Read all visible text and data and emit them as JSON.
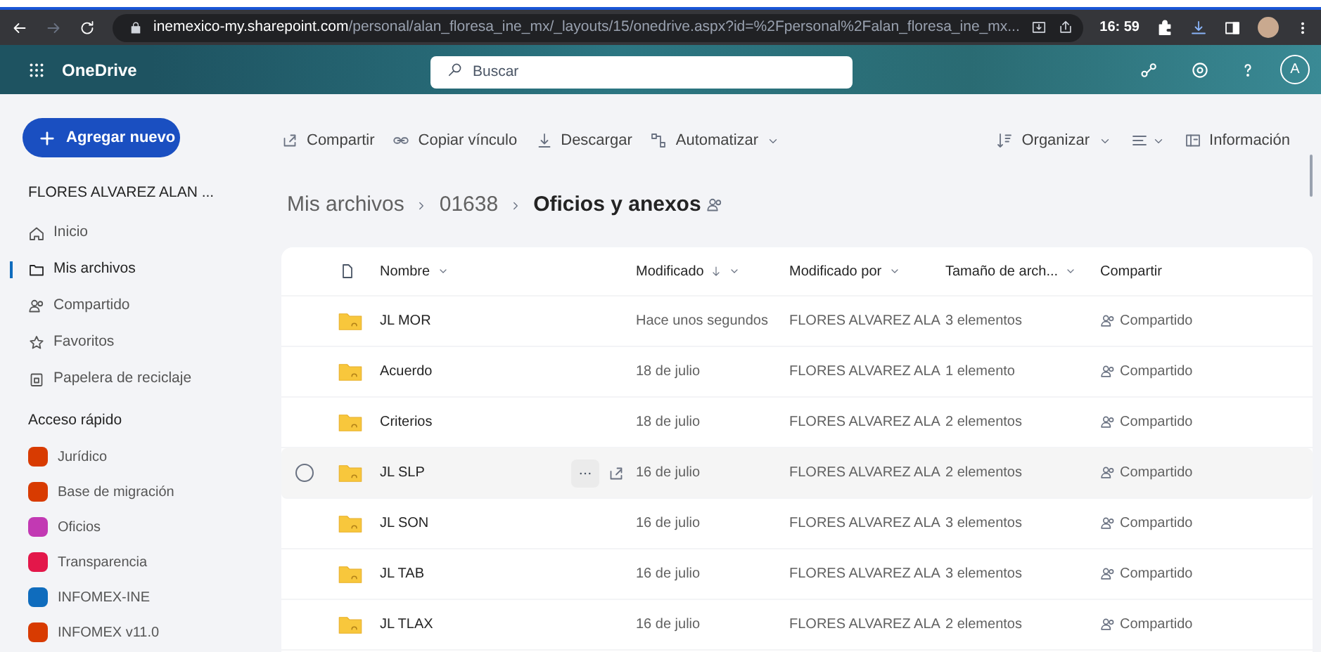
{
  "browser": {
    "url_host": "inemexico-my.sharepoint.com",
    "url_path": "/personal/alan_floresa_ine_mx/_layouts/15/onedrive.aspx?id=%2Fpersonal%2Falan_floresa_ine_mx...",
    "clock": "16: 59"
  },
  "app": {
    "name": "OneDrive",
    "search_placeholder": "Buscar",
    "avatar": "A"
  },
  "new_button": "Agregar nuevo",
  "toolbar_left": [
    {
      "label": "Compartir",
      "dropdown": false
    },
    {
      "label": "Copiar vínculo",
      "dropdown": false
    },
    {
      "label": "Descargar",
      "dropdown": false
    },
    {
      "label": "Automatizar",
      "dropdown": true
    }
  ],
  "toolbar_right": [
    {
      "label": "Organizar",
      "dropdown": true
    },
    {
      "label": "Información",
      "dropdown": false
    }
  ],
  "sidebar": {
    "user": "FLORES ALVAREZ ALAN ...",
    "nav": [
      {
        "label": "Inicio",
        "selected": false
      },
      {
        "label": "Mis archivos",
        "selected": true
      },
      {
        "label": "Compartido",
        "selected": false
      },
      {
        "label": "Favoritos",
        "selected": false
      },
      {
        "label": "Papelera de reciclaje",
        "selected": false
      }
    ],
    "section": "Acceso rápido",
    "quick": [
      {
        "label": "Jurídico",
        "color": "#d83b01"
      },
      {
        "label": "Base de migración",
        "color": "#d83b01"
      },
      {
        "label": "Oficios",
        "color": "#c239b3"
      },
      {
        "label": "Transparencia",
        "color": "#e3174a"
      },
      {
        "label": "INFOMEX-INE",
        "color": "#0f6cbd"
      },
      {
        "label": "INFOMEX v11.0",
        "color": "#d83b01"
      }
    ]
  },
  "breadcrumb": [
    "Mis archivos",
    "01638",
    "Oficios y anexos"
  ],
  "table": {
    "columns": [
      {
        "label": "Nombre",
        "sorted": false,
        "menu": true
      },
      {
        "label": "Modificado",
        "sorted": true,
        "menu": true
      },
      {
        "label": "Modificado por",
        "sorted": false,
        "menu": true
      },
      {
        "label": "Tamaño de arch...",
        "sorted": false,
        "menu": true
      },
      {
        "label": "Compartir",
        "sorted": false,
        "menu": false
      }
    ],
    "rows": [
      {
        "name": "JL MOR",
        "modified": "Hace unos segundos",
        "modified_by": "FLORES ALVAREZ ALA",
        "size": "3 elementos",
        "sharing": "Compartido",
        "hovered": false
      },
      {
        "name": "Acuerdo",
        "modified": "18 de julio",
        "modified_by": "FLORES ALVAREZ ALA",
        "size": "1 elemento",
        "sharing": "Compartido",
        "hovered": false
      },
      {
        "name": "Criterios",
        "modified": "18 de julio",
        "modified_by": "FLORES ALVAREZ ALA",
        "size": "2 elementos",
        "sharing": "Compartido",
        "hovered": false
      },
      {
        "name": "JL SLP",
        "modified": "16 de julio",
        "modified_by": "FLORES ALVAREZ ALA",
        "size": "2 elementos",
        "sharing": "Compartido",
        "hovered": true
      },
      {
        "name": "JL SON",
        "modified": "16 de julio",
        "modified_by": "FLORES ALVAREZ ALA",
        "size": "3 elementos",
        "sharing": "Compartido",
        "hovered": false
      },
      {
        "name": "JL TAB",
        "modified": "16 de julio",
        "modified_by": "FLORES ALVAREZ ALA",
        "size": "3 elementos",
        "sharing": "Compartido",
        "hovered": false
      },
      {
        "name": "JL TLAX",
        "modified": "16 de julio",
        "modified_by": "FLORES ALVAREZ ALA",
        "size": "2 elementos",
        "sharing": "Compartido",
        "hovered": false
      }
    ]
  }
}
